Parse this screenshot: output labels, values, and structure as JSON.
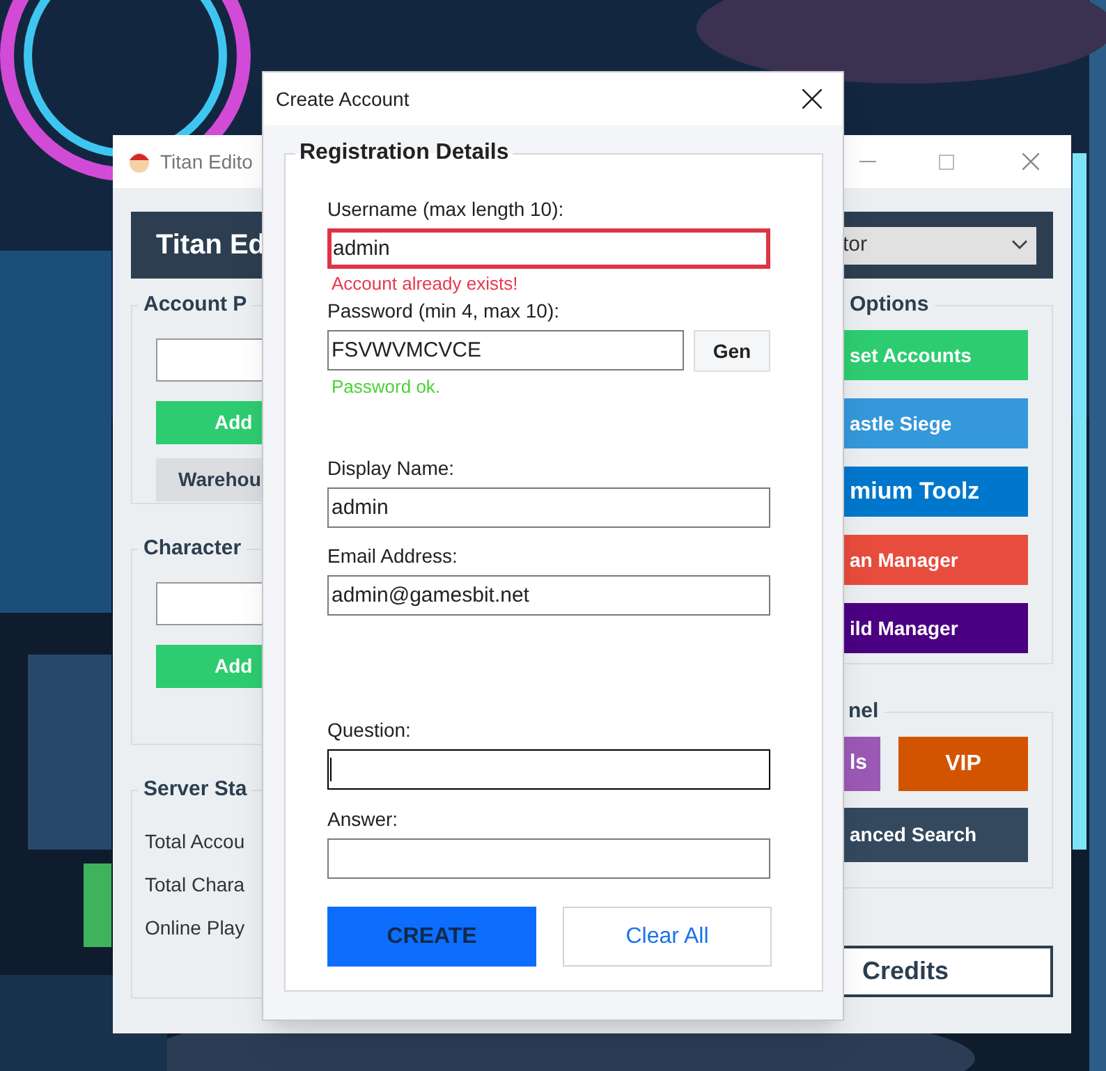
{
  "main_window": {
    "title": "Titan Edito",
    "header": "Titan Ed",
    "server_dropdown": {
      "value": "tor"
    },
    "account_panel": {
      "title": "Account P",
      "buttons": [
        {
          "label": "Add",
          "color": "#2ecc71"
        },
        {
          "label": "Warehou",
          "color": "#dcdde1"
        }
      ]
    },
    "character_panel": {
      "title": "Character",
      "buttons": [
        {
          "label": "Add",
          "color": "#2ecc71"
        }
      ]
    },
    "server_stats": {
      "title": "Server Sta",
      "rows": [
        "Total Accou",
        "Total Chara",
        "Online Play"
      ]
    },
    "options_panel": {
      "title": "Options",
      "buttons": [
        {
          "label": "set Accounts",
          "color": "#2ecc71"
        },
        {
          "label": "astle Siege",
          "color": "#3498db"
        },
        {
          "label": "mium Toolz",
          "color": "#0077cc"
        },
        {
          "label": "an Manager",
          "color": "#e74c3c"
        },
        {
          "label": "ild Manager",
          "color": "#4b0082"
        }
      ]
    },
    "panel": {
      "title": "nel",
      "buttons": [
        {
          "label": "ls",
          "color": "#9b59b6"
        },
        {
          "label": "VIP",
          "color": "#d35400"
        },
        {
          "label": "anced Search",
          "color": "#34495e"
        }
      ]
    },
    "credits_button": "Credits"
  },
  "dialog": {
    "title": "Create Account",
    "group_title": "Registration Details",
    "fields": [
      {
        "label": "Username (max length 10):",
        "value": "admin",
        "invalid": true,
        "focused": false,
        "message": {
          "text": "Account already exists!",
          "color": "#e8384f"
        }
      },
      {
        "label": "Password (min 4, max 10):",
        "value": "FSVWVMCVCE",
        "invalid": false,
        "focused": false,
        "button": "Gen",
        "message": {
          "text": "Password ok.",
          "color": "#4cd137"
        }
      },
      {
        "label": "Display Name:",
        "value": "admin",
        "invalid": false,
        "focused": false
      },
      {
        "label": "Email Address:",
        "value": "admin@gamesbit.net",
        "invalid": false,
        "focused": false
      },
      {
        "label": "Question:",
        "invalid": false,
        "focused": true
      },
      {
        "label": "Answer:",
        "invalid": false,
        "focused": false
      }
    ],
    "buttons": [
      {
        "label": "CREATE",
        "kind": "primary"
      },
      {
        "label": "Clear All",
        "kind": "secondary"
      }
    ]
  }
}
